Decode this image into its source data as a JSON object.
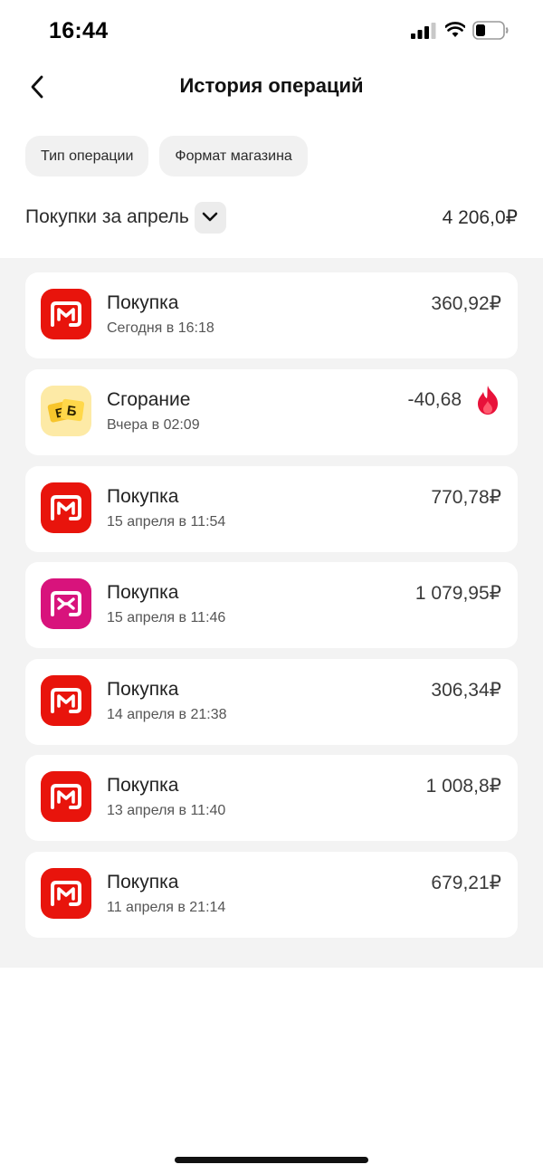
{
  "status_bar": {
    "time": "16:44"
  },
  "header": {
    "title": "История операций"
  },
  "filters": [
    {
      "label": "Тип операции"
    },
    {
      "label": "Формат магазина"
    }
  ],
  "period": {
    "label": "Покупки за апрель",
    "total": "4 206,0₽"
  },
  "operations": [
    {
      "title": "Покупка",
      "date": "Сегодня в 16:18",
      "amount": "360,92₽",
      "icon": "magnit-logo-icon",
      "color": "#e8140c"
    },
    {
      "title": "Сгорание",
      "date": "Вчера в 02:09",
      "amount": "-40,68",
      "icon": "bonus-points-icon",
      "color": "#fdeaa6",
      "status_icon": "flame-icon"
    },
    {
      "title": "Покупка",
      "date": "15 апреля в 11:54",
      "amount": "770,78₽",
      "icon": "magnit-logo-icon",
      "color": "#e8140c"
    },
    {
      "title": "Покупка",
      "date": "15 апреля в 11:46",
      "amount": "1 079,95₽",
      "icon": "magnit-cosmetic-logo-icon",
      "color": "#d8137c"
    },
    {
      "title": "Покупка",
      "date": "14 апреля в 21:38",
      "amount": "306,34₽",
      "icon": "magnit-logo-icon",
      "color": "#e8140c"
    },
    {
      "title": "Покупка",
      "date": "13 апреля в 11:40",
      "amount": "1 008,8₽",
      "icon": "magnit-logo-icon",
      "color": "#e8140c"
    },
    {
      "title": "Покупка",
      "date": "11 апреля в 21:14",
      "amount": "679,21₽",
      "icon": "magnit-logo-icon",
      "color": "#e8140c"
    }
  ],
  "colors": {
    "brand_red": "#e8140c",
    "cosmetic_pink": "#d8137c",
    "bonus_yellow": "#fdeaa6",
    "list_background": "#f3f3f3"
  }
}
